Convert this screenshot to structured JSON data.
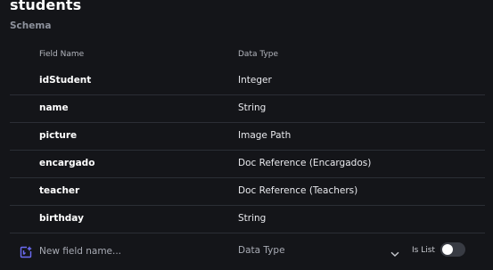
{
  "collection": {
    "title": "students",
    "subtitle": "Schema"
  },
  "table": {
    "headers": {
      "field_name": "Field Name",
      "data_type": "Data Type"
    },
    "rows": [
      {
        "name": "idStudent",
        "type": "Integer"
      },
      {
        "name": "name",
        "type": "String"
      },
      {
        "name": "picture",
        "type": "Image Path"
      },
      {
        "name": "encargado",
        "type": "Doc Reference (Encargados)"
      },
      {
        "name": "teacher",
        "type": "Doc Reference (Teachers)"
      },
      {
        "name": "birthday",
        "type": "String"
      }
    ]
  },
  "new_field": {
    "placeholder": "New field name...",
    "type_placeholder": "Data Type",
    "is_list_label": "Is List",
    "is_list_on": false,
    "icon": "add-field-icon",
    "accent_color": "#6c6cf5"
  }
}
